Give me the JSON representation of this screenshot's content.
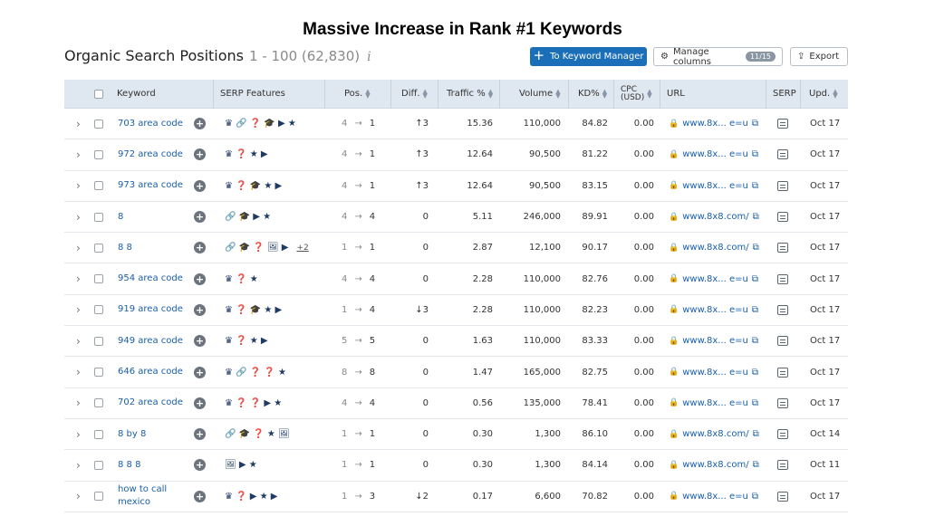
{
  "headline": "Massive Increase in Rank #1 Keywords",
  "header": {
    "title": "Organic Search Positions",
    "range": "1 - 100 (62,830)",
    "info_glyph": "i",
    "to_keyword_manager": "To Keyword Manager",
    "manage_columns": "Manage columns",
    "manage_columns_count": "11/15",
    "export": "Export"
  },
  "columns": {
    "keyword": "Keyword",
    "serp_features": "SERP Features",
    "pos": "Pos.",
    "diff": "Diff.",
    "traffic": "Traffic %",
    "volume": "Volume",
    "kd": "KD%",
    "cpc": "CPC\n(USD)",
    "cpc_line1": "CPC",
    "cpc_line2": "(USD)",
    "url": "URL",
    "serp": "SERP",
    "upd": "Upd."
  },
  "rows": [
    {
      "keyword": "703 area code",
      "serp": "♛ 🔗 ❓ 🎓 ▶ ★",
      "more": "",
      "pos_from": "4",
      "pos_to": "1",
      "diff": "↑3",
      "diff_dir": "up",
      "traffic": "15.36",
      "volume": "110,000",
      "kd": "84.82",
      "cpc": "0.00",
      "url": "www.8x... e=u",
      "upd": "Oct 17"
    },
    {
      "keyword": "972 area code",
      "serp": "♛ ❓ ★ ▶",
      "more": "",
      "pos_from": "4",
      "pos_to": "1",
      "diff": "↑3",
      "diff_dir": "up",
      "traffic": "12.64",
      "volume": "90,500",
      "kd": "81.22",
      "cpc": "0.00",
      "url": "www.8x... e=u",
      "upd": "Oct 17"
    },
    {
      "keyword": "973 area code",
      "serp": "♛ ❓ 🎓 ★ ▶",
      "more": "",
      "pos_from": "4",
      "pos_to": "1",
      "diff": "↑3",
      "diff_dir": "up",
      "traffic": "12.64",
      "volume": "90,500",
      "kd": "83.15",
      "cpc": "0.00",
      "url": "www.8x... e=u",
      "upd": "Oct 17"
    },
    {
      "keyword": "8",
      "serp": "🔗 🎓 ▶ ★",
      "more": "",
      "pos_from": "4",
      "pos_to": "4",
      "diff": "0",
      "diff_dir": "none",
      "traffic": "5.11",
      "volume": "246,000",
      "kd": "89.91",
      "cpc": "0.00",
      "url": "www.8x8.com/",
      "upd": "Oct 17"
    },
    {
      "keyword": "8 8",
      "serp": "🔗 🎓 ❓ 🖼 ▶",
      "more": "+2",
      "pos_from": "1",
      "pos_to": "1",
      "diff": "0",
      "diff_dir": "none",
      "traffic": "2.87",
      "volume": "12,100",
      "kd": "90.17",
      "cpc": "0.00",
      "url": "www.8x8.com/",
      "upd": "Oct 17"
    },
    {
      "keyword": "954 area code",
      "serp": "♛ ❓ ★",
      "more": "",
      "pos_from": "4",
      "pos_to": "4",
      "diff": "0",
      "diff_dir": "none",
      "traffic": "2.28",
      "volume": "110,000",
      "kd": "82.76",
      "cpc": "0.00",
      "url": "www.8x... e=u",
      "upd": "Oct 17"
    },
    {
      "keyword": "919 area code",
      "serp": "♛ ❓ 🎓 ★ ▶",
      "more": "",
      "pos_from": "1",
      "pos_to": "4",
      "diff": "↓3",
      "diff_dir": "down",
      "traffic": "2.28",
      "volume": "110,000",
      "kd": "82.23",
      "cpc": "0.00",
      "url": "www.8x... e=u",
      "upd": "Oct 17"
    },
    {
      "keyword": "949 area code",
      "serp": "♛ ❓ ★ ▶",
      "more": "",
      "pos_from": "5",
      "pos_to": "5",
      "diff": "0",
      "diff_dir": "none",
      "traffic": "1.63",
      "volume": "110,000",
      "kd": "83.33",
      "cpc": "0.00",
      "url": "www.8x... e=u",
      "upd": "Oct 17"
    },
    {
      "keyword": "646 area code",
      "serp": "♛ 🔗 ❓ ❓ ★",
      "more": "",
      "pos_from": "8",
      "pos_to": "8",
      "diff": "0",
      "diff_dir": "none",
      "traffic": "1.47",
      "volume": "165,000",
      "kd": "82.75",
      "cpc": "0.00",
      "url": "www.8x... e=u",
      "upd": "Oct 17"
    },
    {
      "keyword": "702 area code",
      "serp": "♛ ❓ ❓ ▶ ★",
      "more": "",
      "pos_from": "4",
      "pos_to": "4",
      "diff": "0",
      "diff_dir": "none",
      "traffic": "0.56",
      "volume": "135,000",
      "kd": "78.41",
      "cpc": "0.00",
      "url": "www.8x... e=u",
      "upd": "Oct 17"
    },
    {
      "keyword": "8 by 8",
      "serp": "🔗 🎓 ❓ ★ 🖼",
      "more": "",
      "pos_from": "1",
      "pos_to": "1",
      "diff": "0",
      "diff_dir": "none",
      "traffic": "0.30",
      "volume": "1,300",
      "kd": "86.10",
      "cpc": "0.00",
      "url": "www.8x8.com/",
      "upd": "Oct 14"
    },
    {
      "keyword": "8 8 8",
      "serp": "🖼 ▶ ★",
      "more": "",
      "pos_from": "1",
      "pos_to": "1",
      "diff": "0",
      "diff_dir": "none",
      "traffic": "0.30",
      "volume": "1,300",
      "kd": "84.14",
      "cpc": "0.00",
      "url": "www.8x8.com/",
      "upd": "Oct 11"
    },
    {
      "keyword": "how to call mexico",
      "serp": "♛ ❓ ▶ ★ ▶",
      "more": "",
      "pos_from": "1",
      "pos_to": "3",
      "diff": "↓2",
      "diff_dir": "down",
      "traffic": "0.17",
      "volume": "6,600",
      "kd": "70.82",
      "cpc": "0.00",
      "url": "www.8x... e=u",
      "upd": "Oct 17"
    }
  ],
  "colors": {
    "primary": "#1a6fb8",
    "link": "#1a5fa8",
    "up": "#2a9d4c",
    "down": "#d93b2b",
    "header_bg": "#dfe7f1"
  },
  "icons": {
    "expand": "chevron-right-icon",
    "add": "plus-circle-icon",
    "lock": "lock-icon",
    "external": "external-link-icon",
    "serp_snapshot": "serp-snapshot-icon"
  }
}
